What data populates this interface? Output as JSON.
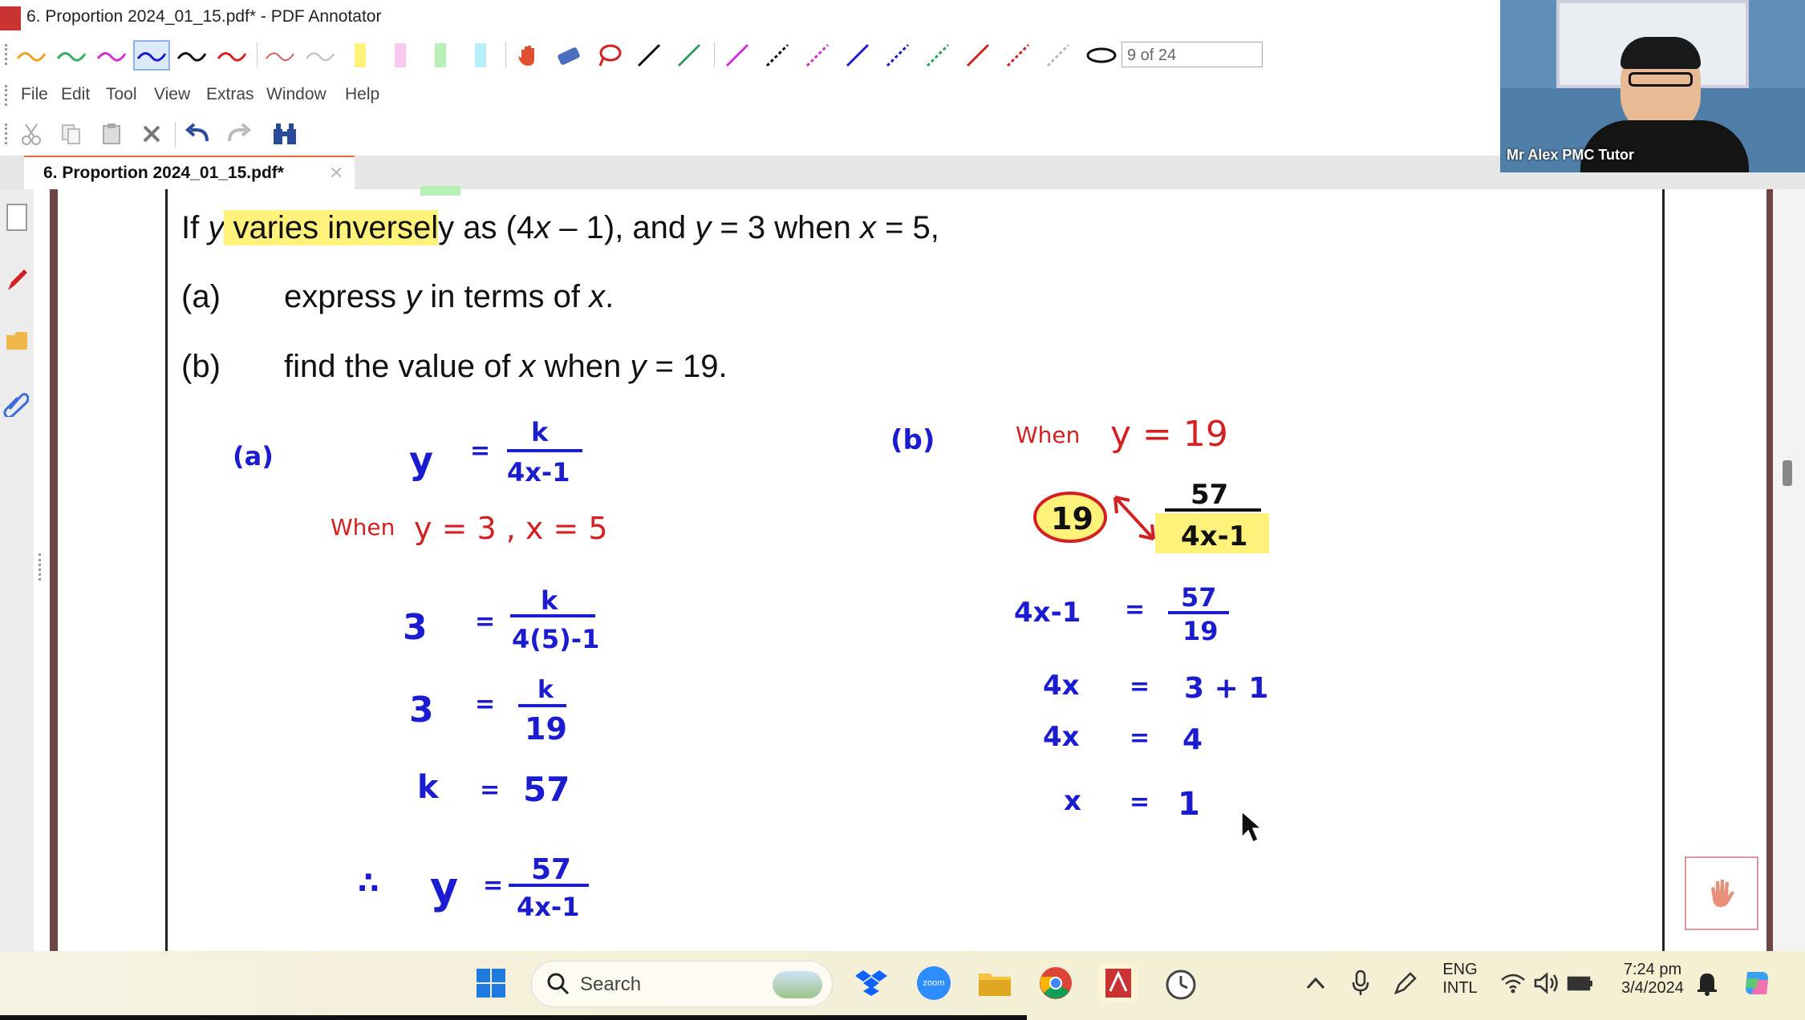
{
  "window": {
    "title": "6. Proportion 2024_01_15.pdf* - PDF Annotator",
    "page_indicator": "9 of 24"
  },
  "menu": [
    "File",
    "Edit",
    "Tool",
    "View",
    "Extras",
    "Window",
    "Help"
  ],
  "tab": {
    "label": "6. Proportion 2024_01_15.pdf*"
  },
  "question": {
    "stem": {
      "p1": "If ",
      "var_y": "y",
      "highlight": " varies inversel",
      "p2": "y as (4",
      "var_x1": "x",
      "p3": " – 1), and ",
      "var_y2": "y",
      "p4": " = 3 when ",
      "var_x2": "x",
      "p5": " = 5,"
    },
    "part_a_label": "(a)",
    "part_a": {
      "t1": "express ",
      "v1": "y",
      "t2": " in terms of ",
      "v2": "x",
      "t3": "."
    },
    "part_b_label": "(b)",
    "part_b": {
      "t1": "find the value of ",
      "v1": "x",
      "t2": " when ",
      "v2": "y",
      "t3": " = 19."
    }
  },
  "handwriting": {
    "a_label": "(a)",
    "a_y": "y",
    "eq": "=",
    "k": "k",
    "den1": "4x-1",
    "when": "When",
    "a_when_vals": "y = 3  ,  x = 5",
    "three": "3",
    "den_sub": "4(5)-1",
    "nineteen": "19",
    "k_eq": "k",
    "fifty_seven": "57",
    "therefore": "∴",
    "b_label": "(b)",
    "b_when_vals": "y = 19",
    "circled_19": "19",
    "b_den": "4x-1",
    "lhs1": "4x-1",
    "lhs2": "4x",
    "rhs2": "3  +  1",
    "lhs3": "4x",
    "rhs3": "4",
    "lhs4": "x",
    "rhs4": "1"
  },
  "webcam": {
    "name": "Mr Alex PMC Tutor"
  },
  "taskbar": {
    "search_placeholder": "Search",
    "lang_top": "ENG",
    "lang_bottom": "INTL",
    "time": "7:24 pm",
    "date": "3/4/2024"
  },
  "colors": {
    "ink_blue": "#1b1bd0",
    "ink_red": "#d42020",
    "highlight": "#fff27a",
    "tab_accent": "#e86b3a"
  }
}
